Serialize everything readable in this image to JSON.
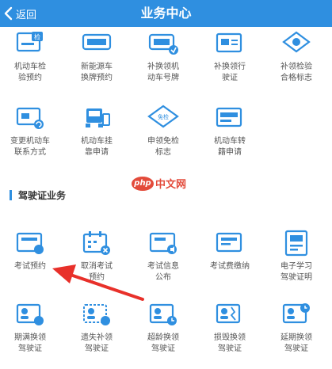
{
  "header": {
    "title": "业务中心",
    "back_label": "返回"
  },
  "vehicle_items": [
    {
      "label": "机动车检\n验预约",
      "icon": "vehicle-doc-icon"
    },
    {
      "label": "新能源车\n换牌预约",
      "icon": "license-plate-icon"
    },
    {
      "label": "补换领机\n动车号牌",
      "icon": "license-plate-replace-icon"
    },
    {
      "label": "补换领行\n驶证",
      "icon": "driving-permit-icon"
    },
    {
      "label": "补领检验\n合格标志",
      "icon": "inspection-badge-icon"
    },
    {
      "label": "变更机动车\n联系方式",
      "icon": "contact-change-icon"
    },
    {
      "label": "机动车挂\n靠申请",
      "icon": "vehicle-affiliation-icon"
    },
    {
      "label": "申领免检\n标志",
      "icon": "exemption-badge-icon"
    },
    {
      "label": "机动车转\n籍申请",
      "icon": "vehicle-transfer-icon"
    }
  ],
  "badges": {
    "check": "检",
    "exempt": "免检"
  },
  "section": {
    "title": "驾驶证业务"
  },
  "license_items": [
    {
      "label": "考试预约",
      "icon": "exam-booking-icon"
    },
    {
      "label": "取消考试\n预约",
      "icon": "cancel-exam-icon"
    },
    {
      "label": "考试信息\n公布",
      "icon": "exam-info-icon"
    },
    {
      "label": "考试费缴纳",
      "icon": "exam-fee-icon"
    },
    {
      "label": "电子学习\n驾驶证明",
      "icon": "e-learning-permit-icon"
    },
    {
      "label": "期满换领\n驾驶证",
      "icon": "license-renew-icon"
    },
    {
      "label": "遗失补领\n驾驶证",
      "icon": "license-lost-icon"
    },
    {
      "label": "超龄换领\n驾驶证",
      "icon": "license-overage-icon"
    },
    {
      "label": "损毁换领\n驾驶证",
      "icon": "license-damaged-icon"
    },
    {
      "label": "延期换领\n驾驶证",
      "icon": "license-extend-icon"
    }
  ],
  "watermark": {
    "badge": "php",
    "text": "中文网"
  },
  "colors": {
    "header": "#2f8fe0",
    "icon_blue": "#2f8fe0",
    "arrow": "#e8302a"
  }
}
